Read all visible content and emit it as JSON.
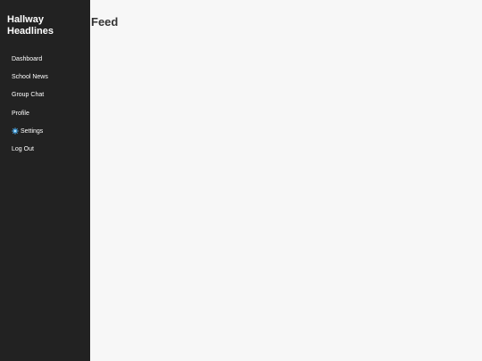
{
  "sidebar": {
    "brand_line1": "Hallway",
    "brand_line2": "Headlines",
    "items": [
      {
        "label": "Dashboard"
      },
      {
        "label": "School News"
      },
      {
        "label": "Group Chat"
      },
      {
        "label": "Profile"
      },
      {
        "label": "Settings",
        "icon": "gear-icon"
      },
      {
        "label": "Log Out"
      }
    ]
  },
  "main": {
    "title": "Feed"
  },
  "colors": {
    "sidebar_bg": "#222222",
    "main_bg": "#f7f7f7",
    "title_color": "#333333",
    "gear_color": "#4aa3df"
  }
}
